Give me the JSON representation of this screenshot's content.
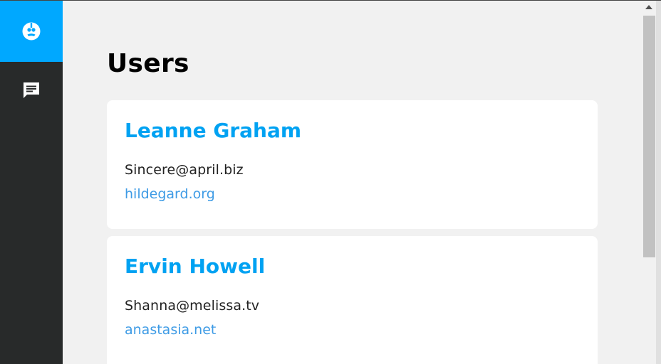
{
  "sidebar": {
    "items": [
      {
        "icon": "face-icon",
        "active": true
      },
      {
        "icon": "message-icon",
        "active": false
      }
    ]
  },
  "main": {
    "title": "Users",
    "users": [
      {
        "name": "Leanne Graham",
        "email": "Sincere@april.biz",
        "website": "hildegard.org"
      },
      {
        "name": "Ervin Howell",
        "email": "Shanna@melissa.tv",
        "website": "anastasia.net"
      }
    ]
  },
  "colors": {
    "accent": "#00a8ff",
    "sidebar_bg": "#282a2a",
    "name_color": "#00a2f2",
    "link_color": "#3e9be5",
    "page_bg": "#f1f1f1"
  }
}
